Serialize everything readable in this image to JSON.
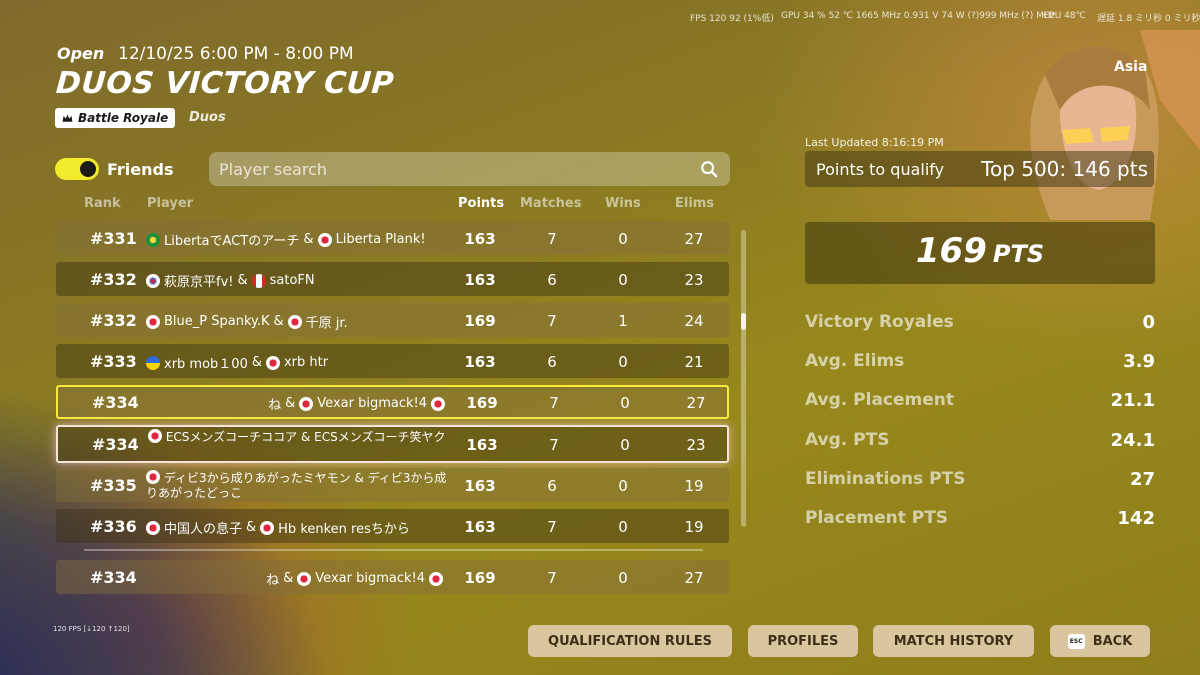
{
  "overlay": {
    "fps": "FPS  120   92 (1%低)",
    "gpu": "GPU  34 %  52 ℃  1665 MHz  0.931 V  74 W  (?)999 MHz  (?) MHz",
    "cpu": "CPU 48℃",
    "ram": "遅延 1.8 ミリ秒  0 ミリ秒",
    "fps_small": "120 FPS [↓120 ↑120]"
  },
  "header": {
    "status": "Open",
    "date": "12/10/25 6:00 PM - 8:00 PM",
    "title": "DUOS VICTORY CUP",
    "mode": "Battle Royale",
    "mode_icon": "crown-icon",
    "team": "Duos"
  },
  "filters": {
    "friends_label": "Friends",
    "friends_on": true,
    "search_placeholder": "Player search"
  },
  "columns": {
    "rank": "Rank",
    "player": "Player",
    "points": "Points",
    "matches": "Matches",
    "wins": "Wins",
    "elims": "Elims"
  },
  "rows": [
    {
      "rank": "#331",
      "p1_flag": "br",
      "p1": "LibertaでACTのアーチ",
      "sep": "&",
      "p2_flag": "jp",
      "p2": "Liberta Plank!",
      "points": "163",
      "matches": "7",
      "wins": "0",
      "elims": "27"
    },
    {
      "rank": "#332",
      "p1_flag": "kr",
      "p1": "萩原京平fv!",
      "sep": "&",
      "p2_flag": "ca",
      "p2": "satoFN",
      "points": "163",
      "matches": "6",
      "wins": "0",
      "elims": "23"
    },
    {
      "rank": "#332",
      "p1_flag": "jp",
      "p1": "Blue_P Spanky.K",
      "sep": "&",
      "p2_flag": "jp",
      "p2": "千原 jr.",
      "points": "169",
      "matches": "7",
      "wins": "1",
      "elims": "24"
    },
    {
      "rank": "#333",
      "p1_flag": "ua",
      "p1": "xrb mob１00",
      "sep": "&",
      "p2_flag": "jp",
      "p2": "xrb htr",
      "points": "163",
      "matches": "6",
      "wins": "0",
      "elims": "21"
    },
    {
      "rank": "#334",
      "p1": "ね",
      "sep": "&",
      "p2_flag": "jp",
      "p2": "Vexar bigmack!4",
      "points": "169",
      "matches": "7",
      "wins": "0",
      "elims": "27"
    },
    {
      "rank": "#334",
      "text": "ECSメンズコーチココア & ECSメンズコーチ笑ヤク",
      "points": "163",
      "matches": "7",
      "wins": "0",
      "elims": "23"
    },
    {
      "rank": "#335",
      "text": "ディビ3から成りあがったミヤモン & ディビ3から成りあがったどっこ",
      "points": "163",
      "matches": "6",
      "wins": "0",
      "elims": "19"
    },
    {
      "rank": "#336",
      "p1_flag": "jp",
      "p1": "中国人の息子",
      "sep": "&",
      "p2_flag": "jp",
      "p2": "Hb kenken resちから",
      "points": "163",
      "matches": "7",
      "wins": "0",
      "elims": "19"
    }
  ],
  "pinned_row": {
    "rank": "#334",
    "p1": "ね",
    "sep": "&",
    "p2_flag": "jp",
    "p2": "Vexar bigmack!4",
    "points": "169",
    "matches": "7",
    "wins": "0",
    "elims": "27"
  },
  "panel": {
    "region": "Asia",
    "last_updated": "Last Updated 8:16:19 PM",
    "qualify_label": "Points to qualify",
    "qualify_value": "Top 500: 146 pts",
    "points_number": "169",
    "points_unit": "PTS",
    "stats": [
      {
        "label": "Victory Royales",
        "value": "0"
      },
      {
        "label": "Avg. Elims",
        "value": "3.9"
      },
      {
        "label": "Avg. Placement",
        "value": "21.1"
      },
      {
        "label": "Avg. PTS",
        "value": "24.1"
      },
      {
        "label": "Eliminations PTS",
        "value": "27"
      },
      {
        "label": "Placement PTS",
        "value": "142"
      }
    ]
  },
  "buttons": {
    "rules": "QUALIFICATION RULES",
    "profiles": "PROFILES",
    "history": "MATCH HISTORY",
    "esc": "ESC",
    "back": "BACK"
  },
  "colors": {
    "accent_yellow": "#f7ea3c",
    "button_bg": "#d9c69e"
  }
}
